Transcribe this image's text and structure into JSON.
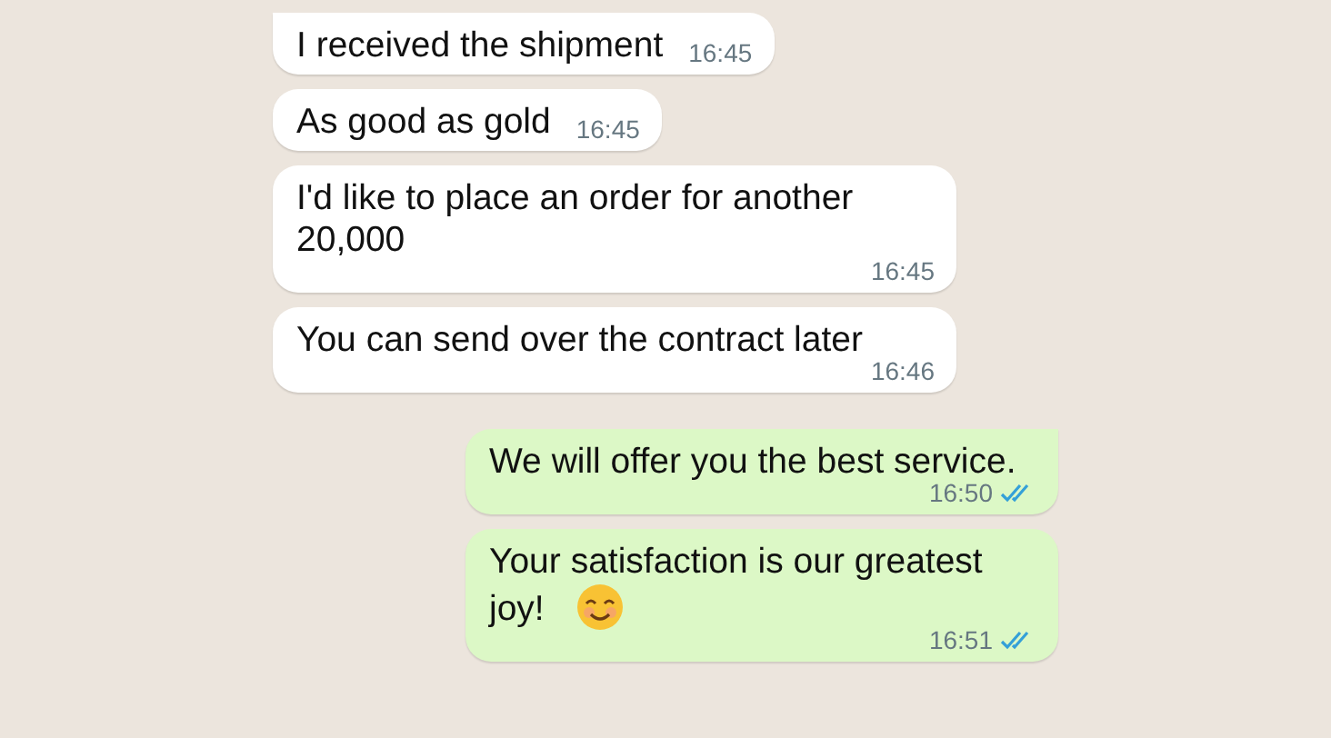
{
  "messages": [
    {
      "kind": "incoming",
      "text": "I received the shipment",
      "time": "16:45",
      "tail": true
    },
    {
      "kind": "incoming",
      "text": "As good as gold",
      "time": "16:45",
      "tail": false
    },
    {
      "kind": "incoming",
      "text": "I'd like to place an order for another 20,000",
      "time": "16:45",
      "tail": false
    },
    {
      "kind": "incoming",
      "text": "You can send over the contract later",
      "time": "16:46",
      "tail": false
    },
    {
      "kind": "outgoing",
      "text": "We will offer you the best service.",
      "time": "16:50",
      "tail": true,
      "read": true,
      "emoji": false
    },
    {
      "kind": "outgoing",
      "text": "Your satisfaction is our greatest joy!",
      "time": "16:51",
      "tail": false,
      "read": true,
      "emoji": true
    }
  ]
}
